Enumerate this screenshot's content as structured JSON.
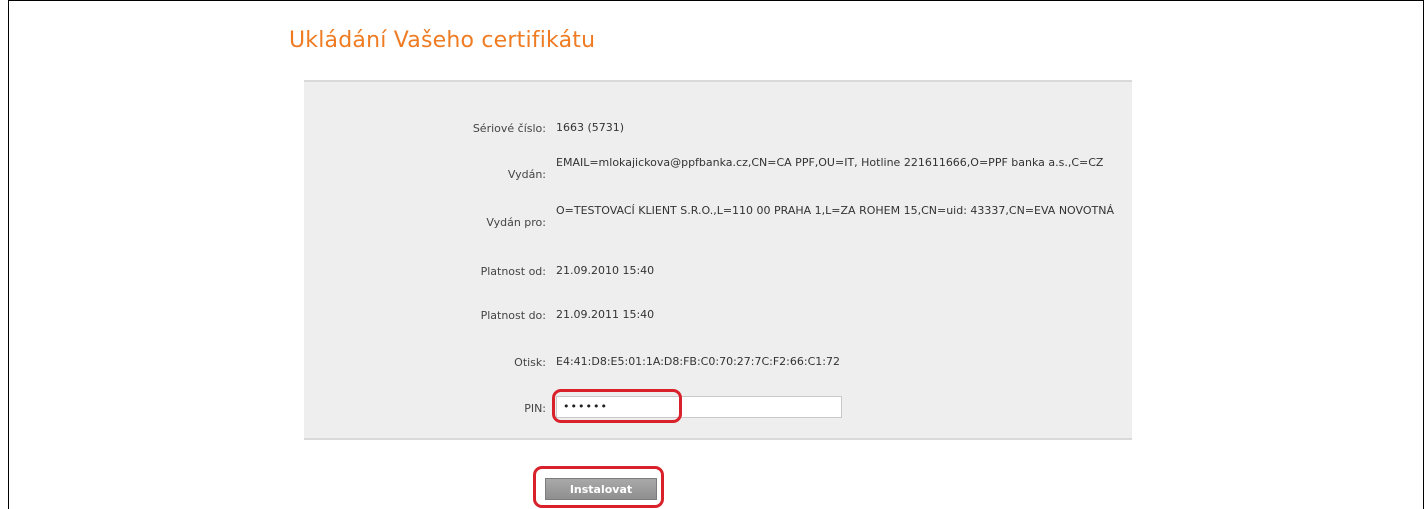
{
  "page": {
    "title": "Ukládání Vašeho certifikátu"
  },
  "certificate": {
    "serial_label": "Sériové číslo:",
    "serial_value": "1663 (5731)",
    "issuer_label": "Vydán:",
    "issuer_value": "EMAIL=mlokajickova@ppfbanka.cz,CN=CA PPF,OU=IT, Hotline 221611666,O=PPF banka a.s.,C=CZ",
    "subject_label": "Vydán pro:",
    "subject_value": "O=TESTOVACÍ KLIENT S.R.O.,L=110 00 PRAHA 1,L=ZA ROHEM 15,CN=uid: 43337,CN=EVA NOVOTNÁ",
    "valid_from_label": "Platnost od:",
    "valid_from_value": "21.09.2010 15:40",
    "valid_to_label": "Platnost do:",
    "valid_to_value": "21.09.2011 15:40",
    "fingerprint_label": "Otisk:",
    "fingerprint_value": "E4:41:D8:E5:01:1A:D8:FB:C0:70:27:7C:F2:66:C1:72",
    "pin_label": "PIN:",
    "pin_value": "••••••"
  },
  "actions": {
    "install_label": "Instalovat"
  },
  "colors": {
    "title": "#ef7b22",
    "highlight": "#d9212b",
    "panel": "#eeeeee"
  }
}
